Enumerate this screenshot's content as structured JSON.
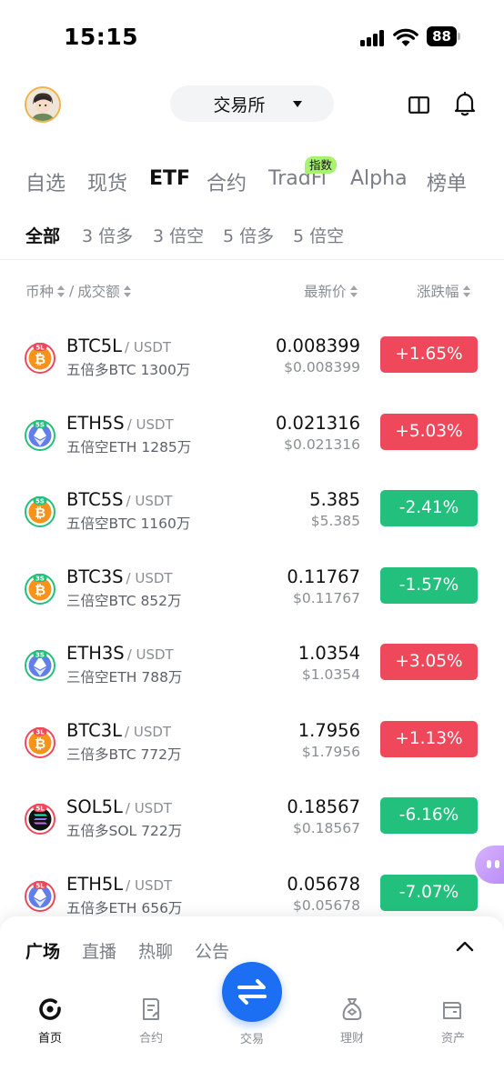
{
  "status_bar": {
    "time": "15:15",
    "battery": "88"
  },
  "header": {
    "exchange_label": "交易所"
  },
  "main_tabs": [
    {
      "label": "自选",
      "active": false
    },
    {
      "label": "现货",
      "active": false
    },
    {
      "label": "ETF",
      "active": true
    },
    {
      "label": "合约",
      "active": false
    },
    {
      "label": "TradFi",
      "active": false,
      "badge": "指数"
    },
    {
      "label": "Alpha",
      "active": false
    },
    {
      "label": "榜单",
      "active": false
    }
  ],
  "sub_tabs": [
    {
      "label": "全部",
      "active": true
    },
    {
      "label": "3 倍多",
      "active": false
    },
    {
      "label": "3 倍空",
      "active": false
    },
    {
      "label": "5 倍多",
      "active": false
    },
    {
      "label": "5 倍空",
      "active": false
    }
  ],
  "columns": {
    "coin": "币种",
    "sep": "/",
    "volume": "成交额",
    "price": "最新价",
    "change": "涨跌幅"
  },
  "rows": [
    {
      "symbol": "BTC5L",
      "quote": "/ USDT",
      "sub": "五倍多BTC 1300万",
      "price": "0.008399",
      "price_usd": "$0.008399",
      "change": "+1.65%",
      "direction": "up",
      "icon": "btc-5l-icon",
      "leverage": "5L"
    },
    {
      "symbol": "ETH5S",
      "quote": "/ USDT",
      "sub": "五倍空ETH 1285万",
      "price": "0.021316",
      "price_usd": "$0.021316",
      "change": "+5.03%",
      "direction": "up",
      "icon": "eth-5s-icon",
      "leverage": "5S"
    },
    {
      "symbol": "BTC5S",
      "quote": "/ USDT",
      "sub": "五倍空BTC 1160万",
      "price": "5.385",
      "price_usd": "$5.385",
      "change": "-2.41%",
      "direction": "down",
      "icon": "btc-5s-icon",
      "leverage": "5S"
    },
    {
      "symbol": "BTC3S",
      "quote": "/ USDT",
      "sub": "三倍空BTC 852万",
      "price": "0.11767",
      "price_usd": "$0.11767",
      "change": "-1.57%",
      "direction": "down",
      "icon": "btc-3s-icon",
      "leverage": "3S"
    },
    {
      "symbol": "ETH3S",
      "quote": "/ USDT",
      "sub": "三倍空ETH 788万",
      "price": "1.0354",
      "price_usd": "$1.0354",
      "change": "+3.05%",
      "direction": "up",
      "icon": "eth-3s-icon",
      "leverage": "3S"
    },
    {
      "symbol": "BTC3L",
      "quote": "/ USDT",
      "sub": "三倍多BTC 772万",
      "price": "1.7956",
      "price_usd": "$1.7956",
      "change": "+1.13%",
      "direction": "up",
      "icon": "btc-3l-icon",
      "leverage": "3L"
    },
    {
      "symbol": "SOL5L",
      "quote": "/ USDT",
      "sub": "五倍多SOL 722万",
      "price": "0.18567",
      "price_usd": "$0.18567",
      "change": "-6.16%",
      "direction": "down",
      "icon": "sol-5l-icon",
      "leverage": "5L"
    },
    {
      "symbol": "ETH5L",
      "quote": "/ USDT",
      "sub": "五倍多ETH 656万",
      "price": "0.05678",
      "price_usd": "$0.05678",
      "change": "-7.07%",
      "direction": "down",
      "icon": "eth-5l-icon",
      "leverage": "5L"
    }
  ],
  "feed_tabs": [
    {
      "label": "广场",
      "active": true
    },
    {
      "label": "直播",
      "active": false
    },
    {
      "label": "热聊",
      "active": false
    },
    {
      "label": "公告",
      "active": false
    }
  ],
  "bottom_nav": [
    {
      "label": "首页",
      "icon": "home-icon",
      "active": true
    },
    {
      "label": "合约",
      "icon": "contract-icon",
      "active": false
    },
    {
      "label": "交易",
      "icon": "trade-swap-icon",
      "active": false
    },
    {
      "label": "理财",
      "icon": "finance-icon",
      "active": false
    },
    {
      "label": "资产",
      "icon": "wallet-icon",
      "active": false
    }
  ],
  "colors": {
    "up": "#f0485b",
    "down": "#23c07d",
    "accent": "#1c6ef2",
    "badge": "#a7f36d"
  }
}
